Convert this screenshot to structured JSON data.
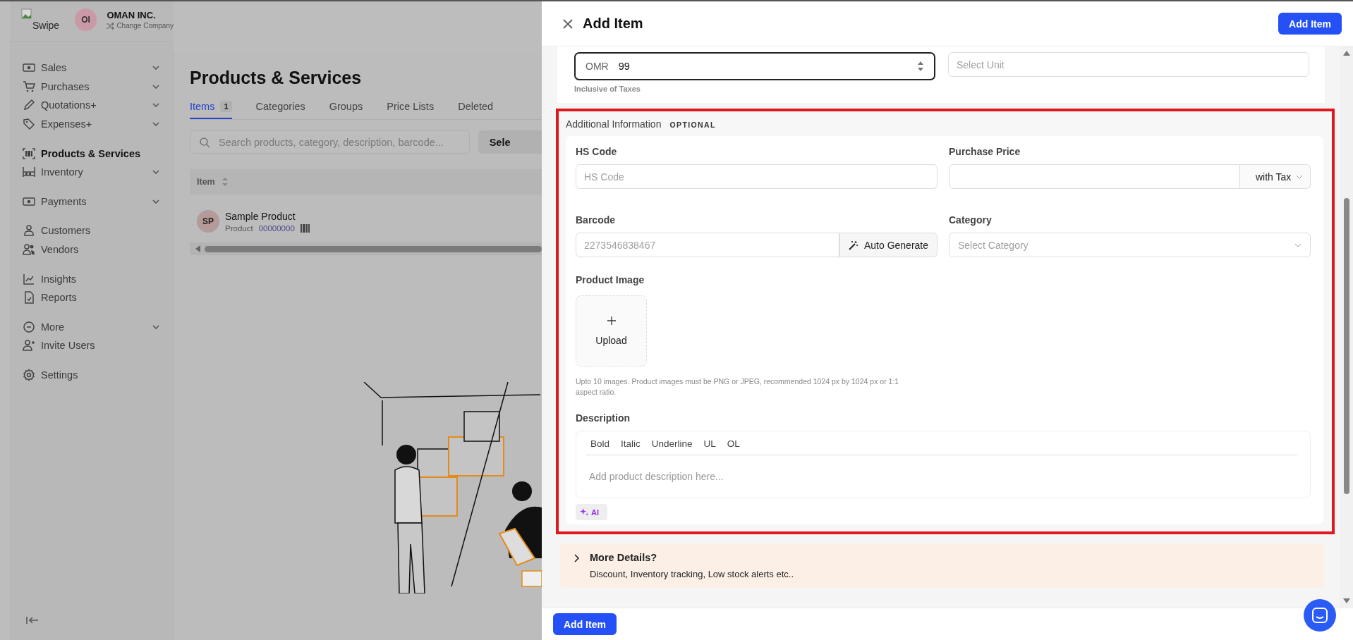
{
  "app": {
    "logo_text": "Swipe",
    "company": {
      "initials": "OI",
      "name": "OMAN INC.",
      "switch_label": "Change Company"
    }
  },
  "sidebar": {
    "items": [
      {
        "label": "Sales",
        "has_submenu": true,
        "selected": false
      },
      {
        "label": "Purchases",
        "has_submenu": true,
        "selected": false
      },
      {
        "label": "Quotations+",
        "has_submenu": true,
        "selected": false
      },
      {
        "label": "Expenses+",
        "has_submenu": true,
        "selected": false
      },
      {
        "label": "Products & Services",
        "has_submenu": false,
        "selected": true
      },
      {
        "label": "Inventory",
        "has_submenu": true,
        "selected": false
      },
      {
        "label": "Payments",
        "has_submenu": true,
        "selected": false
      },
      {
        "label": "Customers",
        "has_submenu": false,
        "selected": false
      },
      {
        "label": "Vendors",
        "has_submenu": false,
        "selected": false
      },
      {
        "label": "Insights",
        "has_submenu": false,
        "selected": false
      },
      {
        "label": "Reports",
        "has_submenu": false,
        "selected": false
      },
      {
        "label": "More",
        "has_submenu": true,
        "selected": false
      },
      {
        "label": "Invite Users",
        "has_submenu": false,
        "selected": false
      },
      {
        "label": "Settings",
        "has_submenu": false,
        "selected": false
      }
    ]
  },
  "page": {
    "title": "Products & Services",
    "tabs": [
      {
        "label": "Items",
        "badge": "1",
        "selected": true
      },
      {
        "label": "Categories",
        "selected": false
      },
      {
        "label": "Groups",
        "selected": false
      },
      {
        "label": "Price Lists",
        "selected": false
      },
      {
        "label": "Deleted",
        "selected": false
      }
    ],
    "search": {
      "placeholder": "Search products, category, description, barcode..."
    },
    "select_button": "Sele",
    "table": {
      "columns": [
        "Item"
      ],
      "rows": [
        {
          "avatar": "SP",
          "name": "Sample Product",
          "type": "Product",
          "code": "00000000"
        }
      ]
    }
  },
  "drawer": {
    "title": "Add Item",
    "header_button": "Add Item",
    "price": {
      "currency": "OMR",
      "value": "99",
      "note": "Inclusive of Taxes"
    },
    "unit": {
      "placeholder": "Select Unit"
    },
    "additional": {
      "title": "Additional Information",
      "tag": "OPTIONAL",
      "highlighted": true,
      "hs_code": {
        "label": "HS Code",
        "placeholder": "HS Code"
      },
      "purchase_price": {
        "label": "Purchase Price",
        "tax_mode": "with Tax"
      },
      "barcode": {
        "label": "Barcode",
        "placeholder": "2273546838467",
        "button": "Auto Generate"
      },
      "category": {
        "label": "Category",
        "placeholder": "Select Category"
      },
      "image": {
        "label": "Product Image",
        "button": "Upload",
        "hint": "Upto 10 images. Product images must be PNG or JPEG, recommended 1024 px by 1024 px or 1:1 aspect ratio."
      },
      "description": {
        "label": "Description",
        "toolbar": [
          "Bold",
          "Italic",
          "Underline",
          "UL",
          "OL"
        ],
        "placeholder": "Add product description here...",
        "ai_button": "AI"
      }
    },
    "more_details": {
      "title": "More Details?",
      "subtitle": "Discount, Inventory tracking, Low stock alerts etc..",
      "expanded": false
    },
    "footer_button": "Add Item"
  }
}
